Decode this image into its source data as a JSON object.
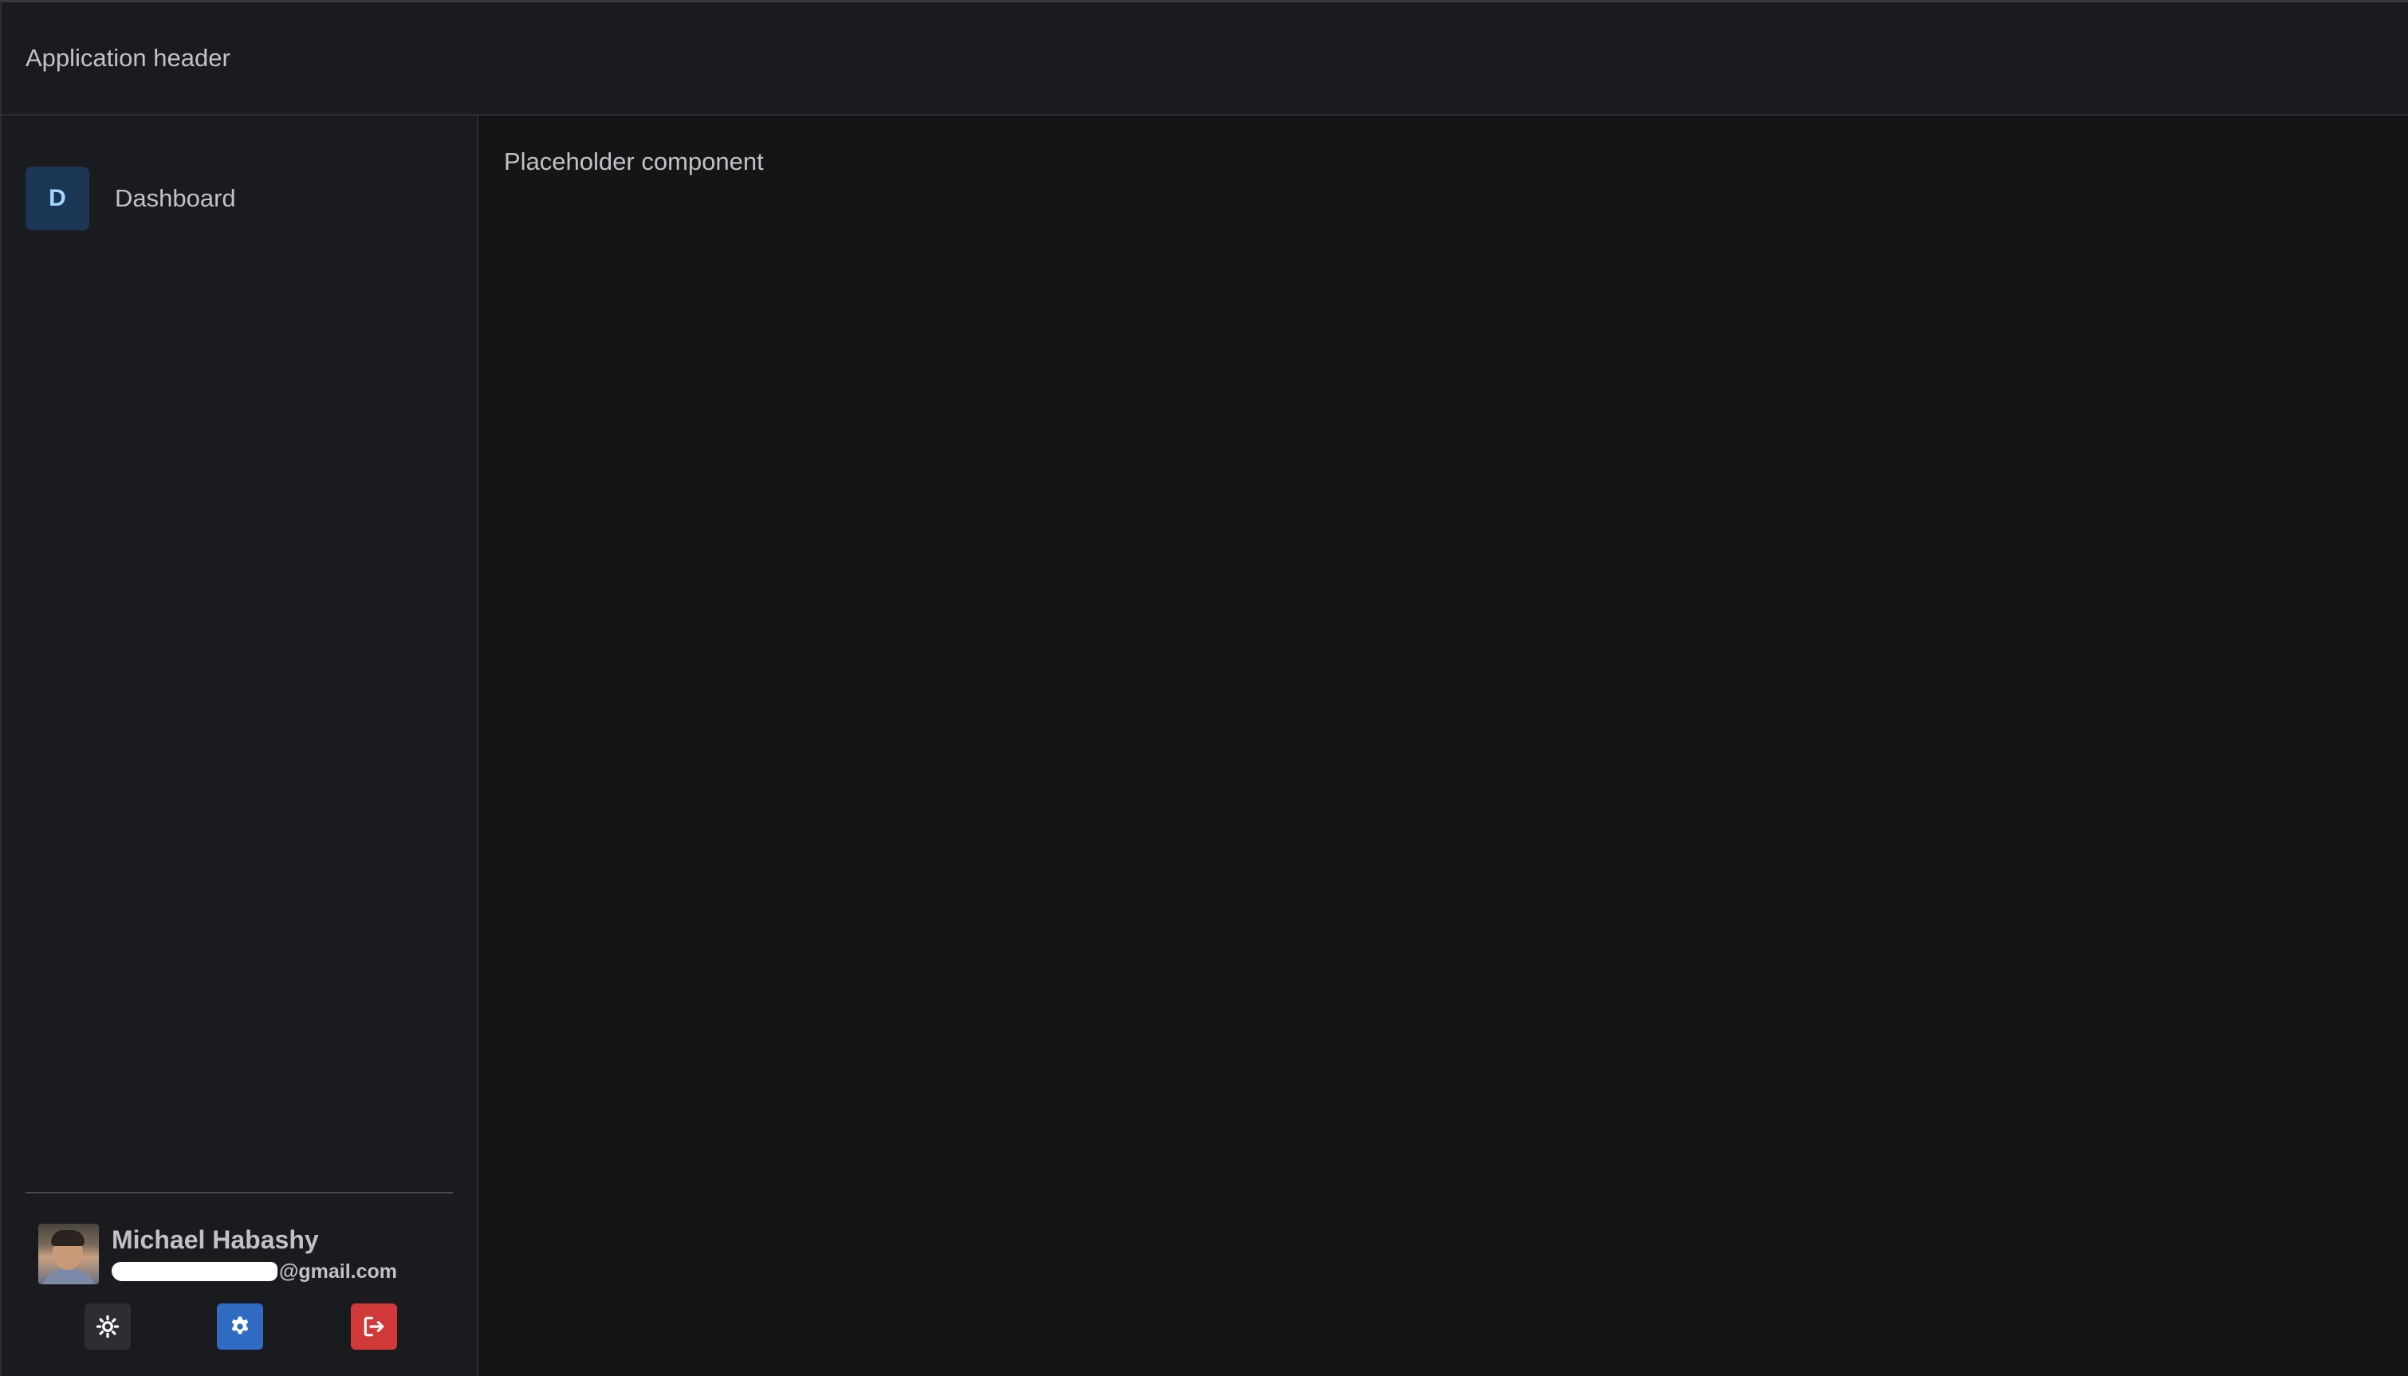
{
  "header": {
    "title": "Application header"
  },
  "sidebar": {
    "items": [
      {
        "badge": "D",
        "label": "Dashboard"
      }
    ],
    "user": {
      "name": "Michael Habashy",
      "email_visible": "@gmail.com"
    },
    "actions": [
      {
        "icon": "sun-icon",
        "label": "Toggle theme"
      },
      {
        "icon": "gear-icon",
        "label": "Settings"
      },
      {
        "icon": "logout-icon",
        "label": "Logout"
      }
    ]
  },
  "main": {
    "placeholder": "Placeholder component"
  },
  "colors": {
    "background": "#141517",
    "panel": "#1a1b1e",
    "border": "#2c2e33",
    "accent_blue": "#2f6bc2",
    "danger_red": "#d23a3a",
    "badge_bg": "#1c3656",
    "badge_text": "#a5d8ff"
  }
}
